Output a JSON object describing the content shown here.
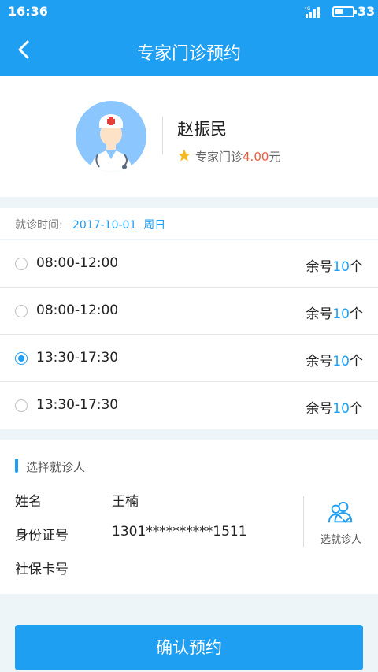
{
  "status_bar": {
    "time": "16:36",
    "network": "4G",
    "battery": "33"
  },
  "navbar": {
    "title": "专家门诊预约",
    "back_icon": "chevron-left-icon"
  },
  "doctor": {
    "name": "赵振民",
    "type_label": "专家门诊",
    "fee": "4.00",
    "fee_unit": "元",
    "star_color": "#f5b921"
  },
  "visit": {
    "label": "就诊时间:",
    "date": "2017-10-01",
    "weekday": "周日"
  },
  "slots": [
    {
      "time": "08:00-12:00",
      "remain_prefix": "余号",
      "remain_num": "10",
      "remain_suffix": "个",
      "checked": false
    },
    {
      "time": "08:00-12:00",
      "remain_prefix": "余号",
      "remain_num": "10",
      "remain_suffix": "个",
      "checked": false
    },
    {
      "time": "13:30-17:30",
      "remain_prefix": "余号",
      "remain_num": "10",
      "remain_suffix": "个",
      "checked": true
    },
    {
      "time": "13:30-17:30",
      "remain_prefix": "余号",
      "remain_num": "10",
      "remain_suffix": "个",
      "checked": false
    }
  ],
  "patient": {
    "section_title": "选择就诊人",
    "name_label": "姓名",
    "name_value": "王楠",
    "id_label": "身份证号",
    "id_value": "1301**********1511",
    "insurance_label": "社保卡号",
    "select_label": "选就诊人",
    "select_icon": "select-patient-icon"
  },
  "confirm_label": "确认预约",
  "colors": {
    "primary": "#1e9ff2",
    "fee": "#ef5a38",
    "background": "#eef5f8"
  }
}
